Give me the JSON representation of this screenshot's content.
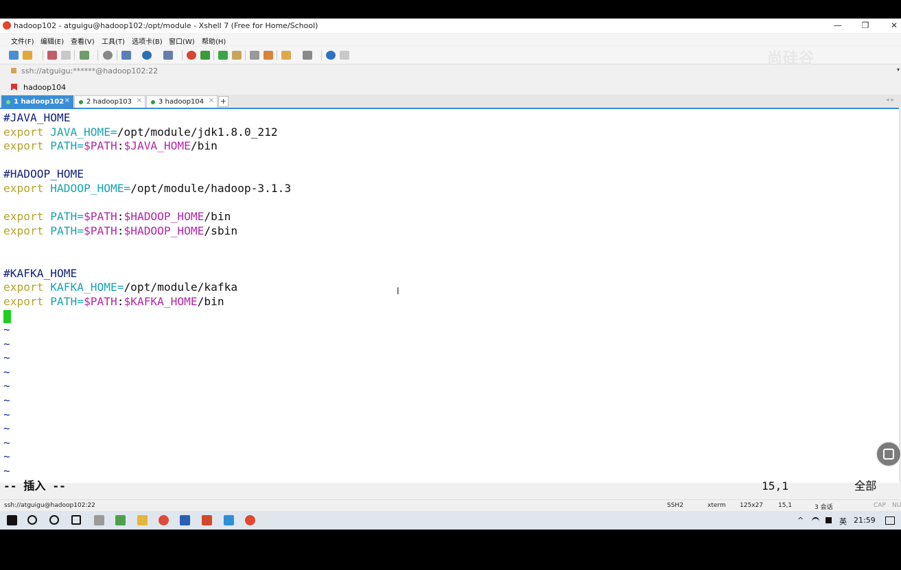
{
  "window": {
    "title": "hadoop102 - atguigu@hadoop102:/opt/module - Xshell 7 (Free for Home/School)",
    "minimize": "—",
    "maximize": "❐",
    "close": "✕"
  },
  "menu": [
    "文件(F)",
    "编辑(E)",
    "查看(V)",
    "工具(T)",
    "选项卡(B)",
    "窗口(W)",
    "帮助(H)"
  ],
  "watermark": "尚硅谷",
  "address": {
    "text": "ssh://atguigu:******@hadoop102:22",
    "drop": "▾"
  },
  "links": {
    "label": "hadoop104"
  },
  "tabs": [
    {
      "label": "1 hadoop102",
      "close": "×",
      "active": true
    },
    {
      "label": "2 hadoop103",
      "close": "×",
      "active": false
    },
    {
      "label": "3 hadoop104",
      "close": "×",
      "active": false
    }
  ],
  "tab_add": "+",
  "tab_nav": "◂ ▸",
  "terminal": {
    "lines": [
      {
        "comment": "#JAVA_HOME"
      },
      {
        "kw": "export",
        "var": "JAVA_HOME=",
        "tail": "/opt/module/jdk1.8.0_212"
      },
      {
        "kw": "export",
        "var": "PATH=",
        "ref1": "$PATH",
        "mid": ":",
        "ref2": "$JAVA_HOME",
        "tail": "/bin"
      },
      {},
      {
        "comment": "#HADOOP_HOME"
      },
      {
        "kw": "export",
        "var": "HADOOP_HOME=",
        "tail": "/opt/module/hadoop-3.1.3"
      },
      {},
      {
        "kw": "export",
        "var": "PATH=",
        "ref1": "$PATH",
        "mid": ":",
        "ref2": "$HADOOP_HOME",
        "tail": "/bin"
      },
      {
        "kw": "export",
        "var": "PATH=",
        "ref1": "$PATH",
        "mid": ":",
        "ref2": "$HADOOP_HOME",
        "tail": "/sbin"
      },
      {},
      {},
      {
        "comment": "#KAFKA_HOME"
      },
      {
        "kw": "export",
        "var": "KAFKA_HOME=",
        "tail": "/opt/module/kafka"
      },
      {
        "kw": "export",
        "var": "PATH=",
        "ref1": "$PATH",
        "mid": ":",
        "ref2": "$KAFKA_HOME",
        "tail": "/bin"
      }
    ],
    "tilde": "~",
    "tilde_count": 11,
    "mode": "-- 插入 --",
    "position": "15,1",
    "scroll": "全部",
    "ibeam": "I"
  },
  "status": {
    "conn": "ssh://atguigu@hadoop102:22",
    "proto": "SSH2",
    "term": "xterm",
    "size": "125x27",
    "pos": "15,1",
    "sessions": "3 会话",
    "cap": "CAP",
    "num": "NUM"
  },
  "taskbar": {
    "time": "21:59",
    "ime": "英",
    "tray_up": "^"
  },
  "colors": {
    "accent": "#3a8ed6",
    "keyword": "#b5a42a",
    "variable": "#19a3b0",
    "reference": "#b526a8",
    "cursor": "#1ed01e"
  }
}
